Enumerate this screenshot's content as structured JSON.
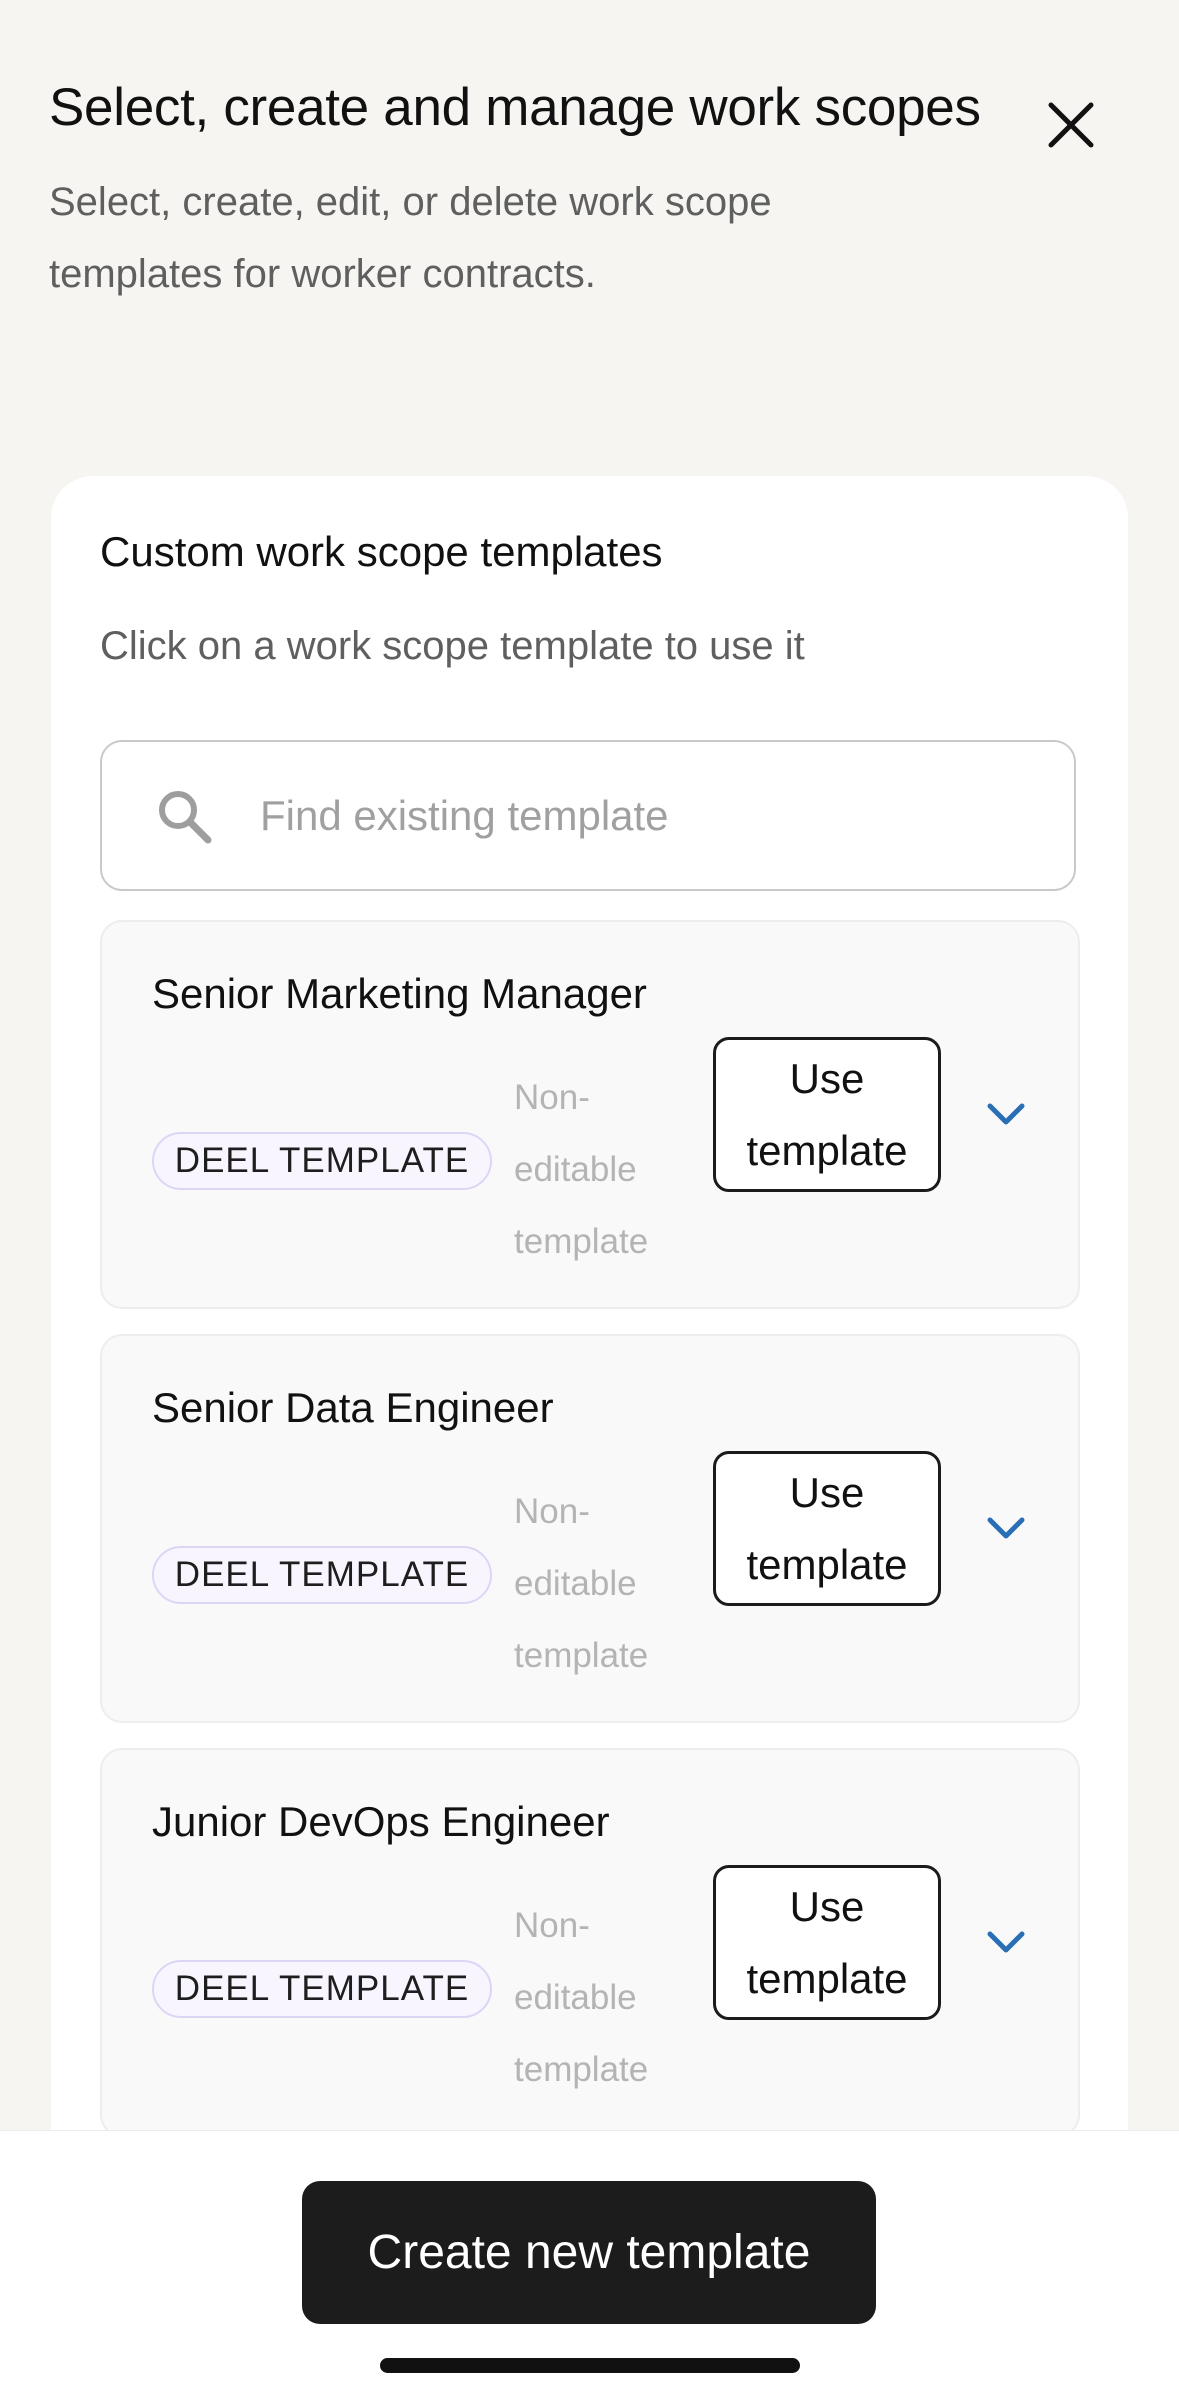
{
  "header": {
    "title": "Select, create and manage work scopes",
    "subtitle": "Select, create, edit, or delete work scope templates for worker contracts.",
    "close_icon": "close-icon"
  },
  "panel": {
    "title": "Custom work scope templates",
    "subtitle": "Click on a work scope template to use it",
    "search": {
      "placeholder": "Find existing template",
      "value": "",
      "icon": "search-icon"
    }
  },
  "templates": [
    {
      "name": "Senior Marketing Manager",
      "badge": "DEEL TEMPLATE",
      "status": "Non-editable template",
      "use_label": "Use template",
      "expand_icon": "chevron-down-icon"
    },
    {
      "name": "Senior Data Engineer",
      "badge": "DEEL TEMPLATE",
      "status": "Non-editable template",
      "use_label": "Use template",
      "expand_icon": "chevron-down-icon"
    },
    {
      "name": "Junior DevOps Engineer",
      "badge": "DEEL TEMPLATE",
      "status": "Non-editable template",
      "use_label": "Use template",
      "expand_icon": "chevron-down-icon"
    }
  ],
  "footer": {
    "create_label": "Create new template"
  },
  "colors": {
    "background": "#f6f5f2",
    "card": "#ffffff",
    "primary_button": "#1c1c1c",
    "badge_border": "#ddd5f6",
    "chevron": "#2a6fb5"
  }
}
